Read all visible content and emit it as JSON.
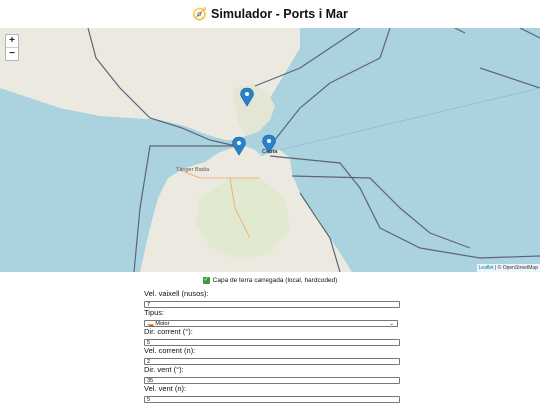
{
  "header": {
    "title": "Simulador - Ports i Mar",
    "icon": "compass-icon"
  },
  "map": {
    "zoom_in_label": "+",
    "zoom_out_label": "−",
    "attribution_leaflet": "Leaflet",
    "attribution_rest": " | © OpenStreetMap",
    "labels": {
      "tangier_bay": "Tànger Badia",
      "ceuta": "Ceuta",
      "marker_label_ceuta": "Ceuta"
    },
    "colors": {
      "sea": "#aad3df",
      "land": "#f0ede5",
      "boundary": "#5f6478",
      "marker": "#2a81cb"
    }
  },
  "status": {
    "text": "Capa de terra carregada (local, hardcoded)",
    "icon": "check-icon"
  },
  "form": {
    "vel_vaixell": {
      "label": "Vel. vaixell (nusos):",
      "value": "7"
    },
    "tipus": {
      "label": "Tipus:",
      "value": "Motor",
      "icon": "boat-icon"
    },
    "dir_corrent": {
      "label": "Dir. corrent (°):",
      "value": "5"
    },
    "vel_corrent": {
      "label": "Vel. corrent (n):",
      "value": "2"
    },
    "dir_vent": {
      "label": "Dir. vent (°):",
      "value": "35"
    },
    "vel_vent": {
      "label": "Vel. vent (n):",
      "value": "5"
    }
  }
}
